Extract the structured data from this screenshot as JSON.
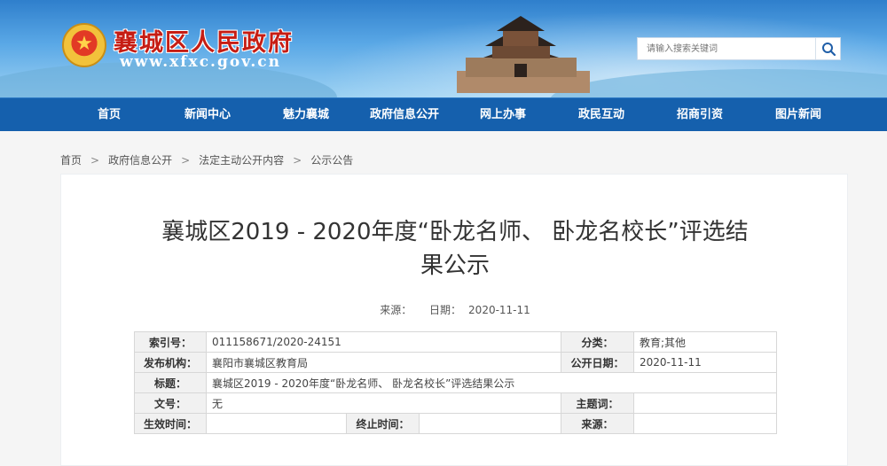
{
  "header": {
    "site_title": "襄城区人民政府",
    "site_url": "www.xfxc.gov.cn",
    "search_placeholder": "请输入搜索关键词"
  },
  "nav": [
    "首页",
    "新闻中心",
    "魅力襄城",
    "政府信息公开",
    "网上办事",
    "政民互动",
    "招商引资",
    "图片新闻"
  ],
  "breadcrumb": [
    "首页",
    "政府信息公开",
    "法定主动公开内容",
    "公示公告"
  ],
  "breadcrumb_sep": ">",
  "article": {
    "title_line1": "襄城区2019 - 2020年度“卧龙名师、 卧龙名校长”评选结",
    "title_line2": "果公示",
    "source_label": "来源：",
    "source_value": "",
    "date_label": "日期：",
    "date_value": "2020-11-11"
  },
  "info_table": {
    "index_label": "索引号：",
    "index_value": "011158671/2020-24151",
    "category_label": "分类：",
    "category_value": "教育;其他",
    "publisher_label": "发布机构：",
    "publisher_value": "襄阳市襄城区教育局",
    "pubdate_label": "公开日期：",
    "pubdate_value": "2020-11-11",
    "title_label": "标题：",
    "title_value": "襄城区2019 - 2020年度“卧龙名师、 卧龙名校长”评选结果公示",
    "docno_label": "文号：",
    "docno_value": "无",
    "keyword_label": "主题词：",
    "keyword_value": "",
    "effective_label": "生效时间：",
    "effective_value": "",
    "expire_label": "终止时间：",
    "expire_value": "",
    "source_label": "来源：",
    "source_value": ""
  },
  "colors": {
    "nav_bg": "#1560ad",
    "title_red": "#c61d14"
  },
  "icons": {
    "search": "search-icon",
    "emblem": "national-emblem-icon"
  }
}
